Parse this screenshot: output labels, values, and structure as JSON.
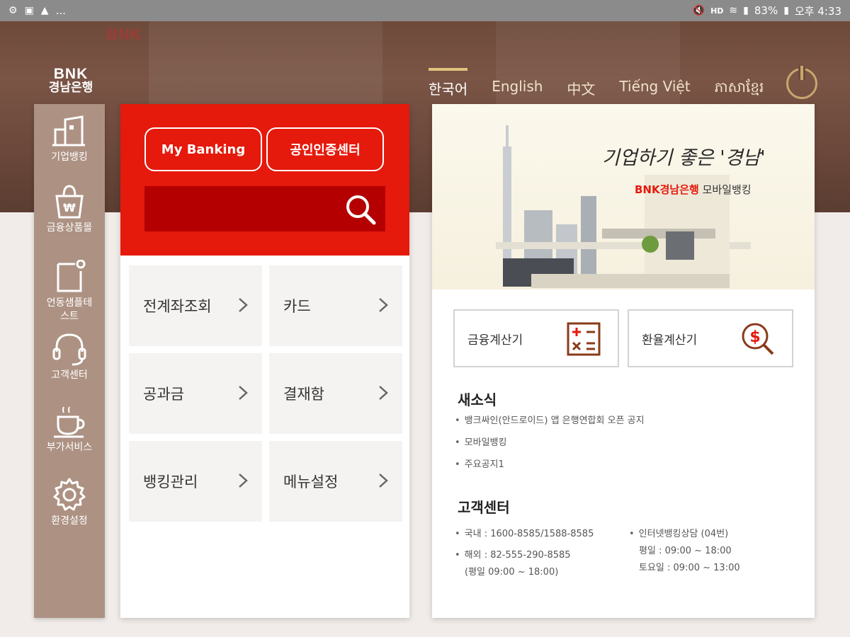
{
  "status_bar": {
    "left_icons": [
      "settings-icon",
      "image-icon",
      "warning-icon"
    ],
    "overflow": "...",
    "battery": "83%",
    "time": "오후 4:33",
    "network": "HD"
  },
  "header": {
    "logo_top": "BNK",
    "logo_bottom": "경남은행",
    "languages": [
      {
        "label": "한국어",
        "active": true
      },
      {
        "label": "English",
        "active": false
      },
      {
        "label": "中文",
        "active": false
      },
      {
        "label": "Tiếng Việt",
        "active": false
      },
      {
        "label": "ភាសាខ្មែរ",
        "active": false
      }
    ],
    "power_icon": "power-icon",
    "accent": "#e0c37f"
  },
  "sidebar": {
    "items": [
      {
        "label": "기업뱅킹",
        "icon": "building-icon"
      },
      {
        "label": "금융상품몰",
        "icon": "shopping-bag-won-icon"
      },
      {
        "label": "언동샘플테스트",
        "icon": "note-icon"
      },
      {
        "label": "고객센터",
        "icon": "headset-icon"
      },
      {
        "label": "부가서비스",
        "icon": "coffee-cup-icon"
      },
      {
        "label": "환경설정",
        "icon": "gear-icon"
      }
    ]
  },
  "mid": {
    "buttons": [
      "My Banking",
      "공인인증센터"
    ],
    "search_icon": "search-icon",
    "menu": [
      {
        "label": "전계좌조회"
      },
      {
        "label": "카드"
      },
      {
        "label": "공과금"
      },
      {
        "label": "결재함"
      },
      {
        "label": "뱅킹관리"
      },
      {
        "label": "메뉴설정"
      }
    ],
    "brand_red": "#e5190c"
  },
  "right": {
    "banner_title": "기업하기 좋은 '경남'",
    "banner_brand": "BNK경남은행",
    "banner_sub": "모바일뱅킹",
    "calculators": [
      {
        "label": "금융계산기",
        "icon": "calculator-icon"
      },
      {
        "label": "환율계산기",
        "icon": "currency-search-icon"
      }
    ],
    "news_title": "새소식",
    "news": [
      "뱅크싸인(안드로이드) 앱 은행연합회 오픈 공지",
      "모바일뱅킹",
      "주요공지1"
    ],
    "cs_title": "고객센터",
    "cs_domestic": "국내 : 1600-8585/1588-8585",
    "cs_overseas": "해외 : 82-555-290-8585",
    "cs_overseas_hours": "(평일 09:00 ~ 18:00)",
    "cs_internet": "인터넷뱅킹상담 (04번)",
    "cs_weekday": "평일 : 09:00 ~ 18:00",
    "cs_saturday": "토요일 : 09:00 ~ 13:00"
  }
}
